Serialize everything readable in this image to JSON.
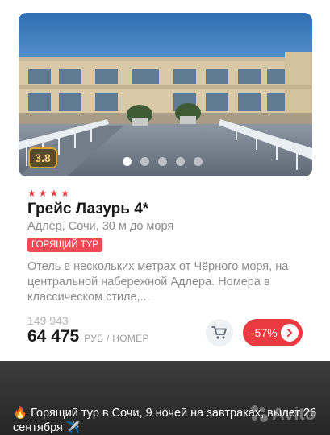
{
  "card": {
    "rating": "3.8",
    "photo_dots": {
      "count": 5,
      "active_index": 0
    },
    "stars": 4,
    "hotel_name": "Грейс Лазурь 4*",
    "location": "Адлер, Сочи, 30 м до моря",
    "badge": "ГОРЯЩИЙ ТУР",
    "description": "Отель в нескольких метрах от Чёрного моря, на центральной набережной Адлера. Номера в классическом стиле,...",
    "old_price": "149 943",
    "price": "64 475",
    "price_unit": "РУБ / НОМЕР",
    "discount": "-57%",
    "icons": {
      "cart": "cart-icon",
      "arrow": "chevron-right-icon",
      "star": "star-icon"
    },
    "colors": {
      "accent": "#e93a41",
      "rating_gold": "#d4a63f"
    }
  },
  "caption": {
    "text": "🔥 Горящий тур в Сочи, 9 ночей на завтраках, вылет 26 сентября ✈️",
    "watermark": "Avito"
  }
}
